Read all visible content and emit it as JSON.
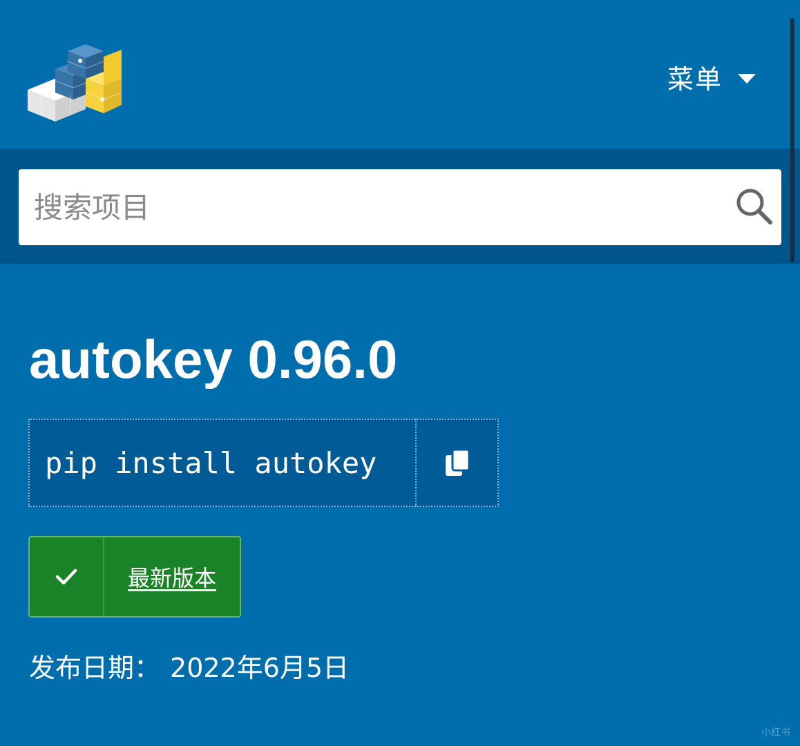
{
  "header": {
    "menu_label": "菜单"
  },
  "search": {
    "placeholder": "搜索项目"
  },
  "project": {
    "title": "autokey 0.96.0",
    "install_command": "pip install autokey",
    "status_label": "最新版本",
    "release_label": "发布日期：",
    "release_date": "2022年6月5日"
  },
  "watermark": "小红书",
  "icons": {
    "logo": "python-logo",
    "menu": "caret-down-icon",
    "search": "search-icon",
    "copy": "copy-icon",
    "check": "check-icon"
  },
  "colors": {
    "brand_blue": "#006dad",
    "search_band": "#00558c",
    "status_green": "#1a8327",
    "python_blue": "#3775a9",
    "python_yellow": "#f7d23f"
  }
}
